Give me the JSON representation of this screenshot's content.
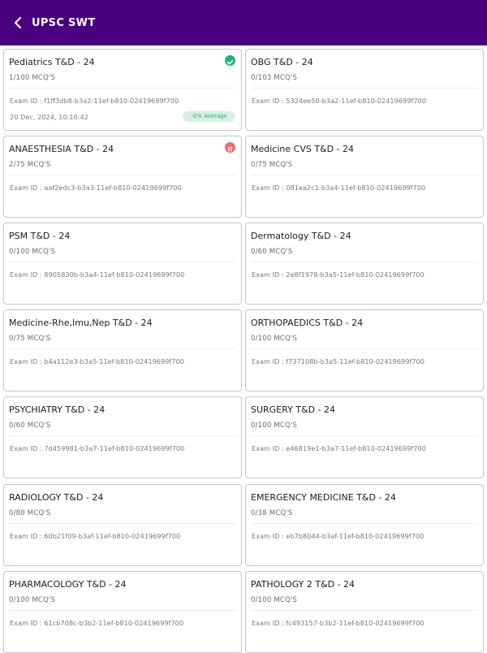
{
  "header": {
    "title": "UPSC SWT"
  },
  "exams": [
    {
      "title": "Pediatrics T&D - 24",
      "count": "1/100 MCQ'S",
      "exam_id": "Exam ID : f1ff3db8-b3a2-11ef-b810-02419699f700",
      "date": "20 Dec, 2024, 10:10:42",
      "average": "-0% Average",
      "status": "completed"
    },
    {
      "title": "OBG T&D - 24",
      "count": "0/103 MCQ'S",
      "exam_id": "Exam ID : 5324ee50-b3a2-11ef-b810-02419699f700"
    },
    {
      "title": "ANAESTHESIA T&D - 24",
      "count": "2/75 MCQ'S",
      "exam_id": "Exam ID : aaf2edc3-b3a3-11ef-b810-02419699f700",
      "status": "paused"
    },
    {
      "title": "Medicine CVS T&D - 24",
      "count": "0/75 MCQ'S",
      "exam_id": "Exam ID : 081ea2c1-b3a4-11ef-b810-02419699f700"
    },
    {
      "title": "PSM T&D - 24",
      "count": "0/100 MCQ'S",
      "exam_id": "Exam ID : 8905830b-b3a4-11ef-b810-02419699f700"
    },
    {
      "title": "Dermatology T&D - 24",
      "count": "0/60 MCQ'S",
      "exam_id": "Exam ID : 2e8f1978-b3a5-11ef-b810-02419699f700"
    },
    {
      "title": "Medicine-Rhe,Imu,Nep T&D - 24",
      "count": "0/75 MCQ'S",
      "exam_id": "Exam ID : b4a112e3-b3a5-11ef-b810-02419699f700"
    },
    {
      "title": "ORTHOPAEDICS T&D - 24",
      "count": "0/100 MCQ'S",
      "exam_id": "Exam ID : f737108b-b3a5-11ef-b810-02419699f700"
    },
    {
      "title": "PSYCHIATRY T&D - 24",
      "count": "0/60 MCQ'S",
      "exam_id": "Exam ID : 7d459981-b3a7-11ef-b810-02419699f700"
    },
    {
      "title": "SURGERY T&D - 24",
      "count": "0/100 MCQ'S",
      "exam_id": "Exam ID : e46819e1-b3a7-11ef-b810-02419699f700"
    },
    {
      "title": "RADIOLOGY T&D - 24",
      "count": "0/80 MCQ'S",
      "exam_id": "Exam ID : 60b21f09-b3af-11ef-b810-02419699f700"
    },
    {
      "title": "EMERGENCY MEDICINE T&D - 24",
      "count": "0/38 MCQ'S",
      "exam_id": "Exam ID : eb7b8044-b3af-11ef-b810-02419699f700"
    },
    {
      "title": "PHARMACOLOGY T&D - 24",
      "count": "0/100 MCQ'S",
      "exam_id": "Exam ID : 61cb708c-b3b2-11ef-b810-02419699f700"
    },
    {
      "title": "PATHOLOGY 2 T&D - 24",
      "count": "0/100 MCQ'S",
      "exam_id": "Exam ID : fc493157-b3b2-11ef-b810-02419699f700"
    }
  ],
  "colors": {
    "appbar": "#4a007e",
    "completed": "#1fb37a",
    "paused": "#ef6b6b",
    "card_border": "#c6c1e3"
  },
  "icons": {
    "back": "back-arrow-icon",
    "completed": "check-circle-icon",
    "paused": "pause-circle-icon"
  }
}
